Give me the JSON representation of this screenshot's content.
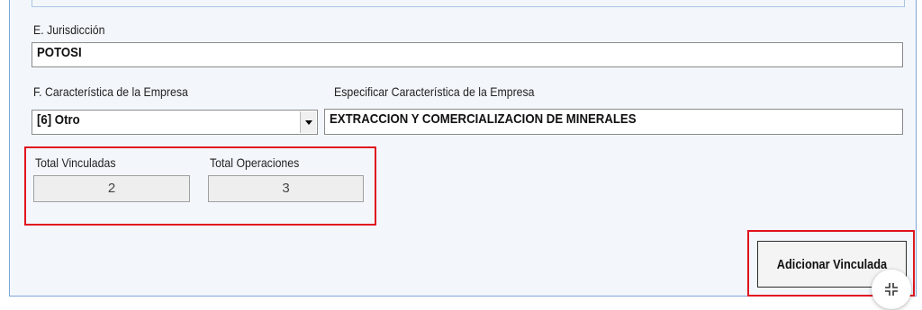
{
  "jurisdiccion": {
    "label": "E. Jurisdicción",
    "value": "POTOSI"
  },
  "caracteristica": {
    "label": "F. Característica  de la Empresa",
    "selected": "[6] Otro"
  },
  "especificar": {
    "label": "Especificar Característica  de la Empresa",
    "value": "EXTRACCION Y COMERCIALIZACION DE MINERALES"
  },
  "totals": {
    "vinculadas_label": "Total Vinculadas",
    "vinculadas_value": "2",
    "operaciones_label": "Total Operaciones",
    "operaciones_value": "3"
  },
  "actions": {
    "add_label": "Adicionar Vinculada"
  },
  "overlay": {
    "icon": "collapse-icon"
  },
  "colors": {
    "highlight": "#e0141e",
    "panel_border": "#7ea6d8",
    "panel_bg": "#f3f7fc"
  }
}
